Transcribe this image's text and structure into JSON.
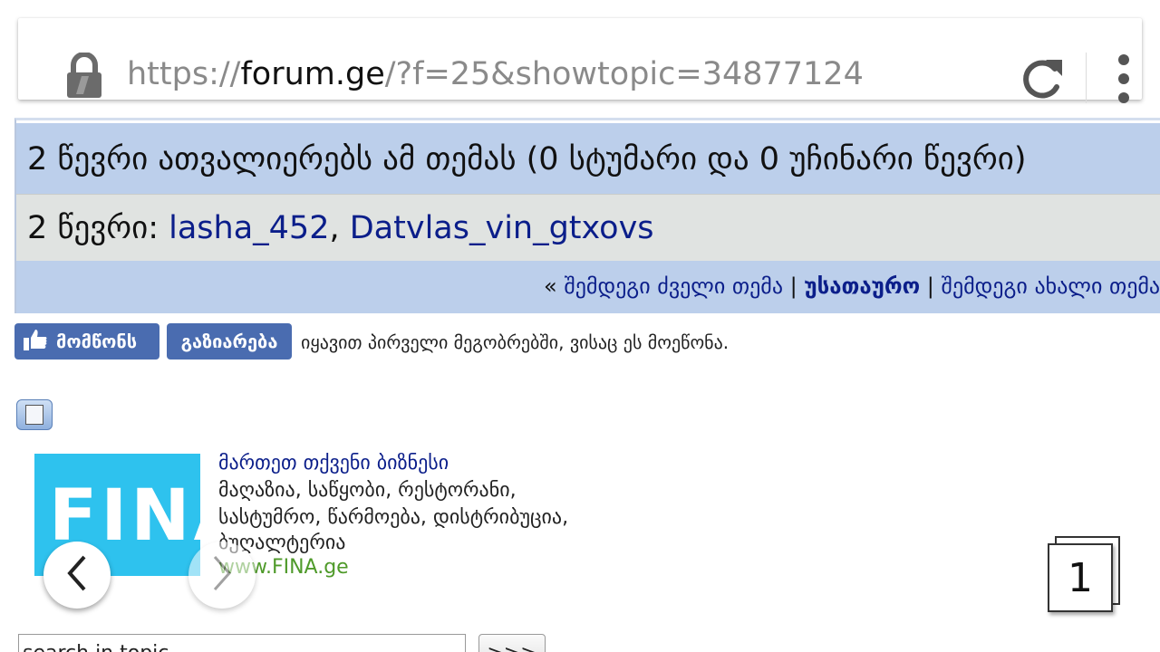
{
  "browser": {
    "url_scheme": "https://",
    "url_host": "forum.ge",
    "url_path": "/?f=25&showtopic=34877124"
  },
  "topic": {
    "viewers_text": "2 წევრი ათვალიერებს ამ თემას (0 სტუმარი და 0 უჩინარი წევრი)",
    "members_prefix": "2 წევრი: ",
    "members": [
      "lasha_452",
      "Datvlas_vin_gtxovs"
    ],
    "members_sep": ", ",
    "nav": {
      "open": "« ",
      "older": "შემდეგი ძველი თემა",
      "sep": " | ",
      "current": "უსათაურო",
      "newer": "შემდეგი ახალი თემა »"
    }
  },
  "social": {
    "like_label": "მომწონს",
    "share_label": "გაზიარება",
    "friends_text": "იყავით პირველი მეგობრებში, ვისაც ეს მოეწონა."
  },
  "ad": {
    "logo_text": "FINA",
    "title": "მართეთ თქვენი ბიზნესი",
    "line1": "მაღაზია, საწყობი, რესტორანი,",
    "line2": "სასტუმრო, წარმოება, დისტრიბუცია,",
    "line3": "ბუღალტერია",
    "url": "www.FINA.ge"
  },
  "tabs": {
    "count": "1"
  },
  "search": {
    "value": "search in topic",
    "go_label": ">>>"
  },
  "colors": {
    "header_blue": "#bccfeb",
    "link_blue": "#0b1e8a",
    "facebook_blue": "#4a6cb0",
    "ad_cyan": "#2ec2ee",
    "ad_url_green": "#4f9a2a"
  },
  "icons": [
    "lock-icon",
    "reload-icon",
    "overflow-menu-icon",
    "thumbs-up-icon",
    "topic-options-icon",
    "chevron-left-icon",
    "chevron-right-icon",
    "tab-switcher-icon"
  ]
}
